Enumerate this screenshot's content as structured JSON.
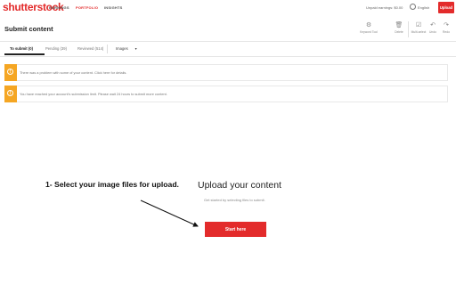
{
  "topbar": {
    "logo": "shutterstock",
    "nav": [
      "EARNINGS",
      "PORTFOLIO",
      "INSIGHTS"
    ],
    "unpaid_earnings": "Unpaid earnings: $0.00",
    "language": "English",
    "upload_label": "Upload",
    "brand_color": "#e32b2b"
  },
  "header": {
    "title": "Submit content",
    "tools": [
      {
        "label": "Keyword Tool",
        "icon": "keyword-tool-icon"
      },
      {
        "label": "Delete",
        "icon": "trash-icon"
      },
      {
        "label": "Multi-select",
        "icon": "multi-select-icon"
      },
      {
        "label": "Undo",
        "icon": "undo-icon"
      },
      {
        "label": "Redo",
        "icon": "redo-icon"
      }
    ]
  },
  "tabs": {
    "items": [
      "To submit (0)",
      "Pending (39)",
      "Reviewed (514)"
    ],
    "filter": "Images"
  },
  "alerts": [
    "There was a problem with some of your content. Click here for details.",
    "You have reached your account's submission limit. Please wait 24 hours to submit more content."
  ],
  "main": {
    "annotation": "1- Select your image files for upload.",
    "upload_title": "Upload your content",
    "upload_subtitle": "Get started by selecting files to submit.",
    "start_button": "Start here"
  }
}
